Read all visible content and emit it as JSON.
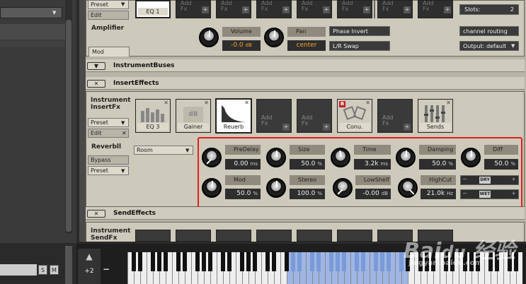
{
  "top": {
    "preset_label": "Preset",
    "edit_label": "Edit",
    "eq_slot": "EQ 1",
    "add_fx": [
      "Add",
      "Fx"
    ],
    "slots_label": "Slots:",
    "slots_value": "2"
  },
  "amplifier": {
    "title": "Amplifier",
    "volume_label": "Volume",
    "volume_value": "-0.0",
    "volume_unit": "dB",
    "pan_label": "Pan",
    "pan_value": "center",
    "phase_invert": "Phase Invert",
    "lr_swap": "L/R Swap",
    "channel_routing": "channel routing",
    "output": "Output: default",
    "mod_tab": "Mod"
  },
  "instrument_buses": {
    "title": "InstrumentBuses"
  },
  "insert_effects": {
    "title": "InsertEffects",
    "label_line1": "Instrument",
    "label_line2": "InsertFx",
    "preset_label": "Preset",
    "edit_label": "Edit",
    "slots": [
      "EQ 3",
      "Gainer",
      "Reuerb",
      "",
      "",
      "Conu.",
      "",
      "Sends"
    ],
    "gainer_tag": "dB",
    "conv_tag": "B",
    "reverb_title": "Reverbll",
    "bypass_label": "Bypass",
    "preset2_label": "Preset",
    "room_select": "Room",
    "knobs": [
      {
        "label": "PreDelay",
        "value": "0.00",
        "unit": "ms"
      },
      {
        "label": "Size",
        "value": "50.0",
        "unit": "%"
      },
      {
        "label": "Time",
        "value": "3.2k",
        "unit": "ms"
      },
      {
        "label": "Damping",
        "value": "50.0",
        "unit": "%"
      },
      {
        "label": "Diff",
        "value": "50.0",
        "unit": "%"
      },
      {
        "label": "Mod",
        "value": "50.0",
        "unit": "%"
      },
      {
        "label": "Stereo",
        "value": "100.0",
        "unit": "%"
      },
      {
        "label": "LowShelf",
        "value": "-0.00",
        "unit": "dB"
      },
      {
        "label": "HighCut",
        "value": "21.0k",
        "unit": "Hz"
      }
    ],
    "dry_label": "DRY",
    "wet_label": "WET"
  },
  "send_effects": {
    "title": "SendEffects",
    "label_line1": "Instrument",
    "label_line2": "SendFx"
  },
  "keyboard": {
    "transpose": "+2",
    "minus": "−"
  },
  "left_pane": {
    "s_btn": "S",
    "m_btn": "M"
  },
  "colors": {
    "accent_orange": "#f4a030",
    "highlight_red": "#e0201c",
    "key_blue": "#7a9ad8"
  }
}
